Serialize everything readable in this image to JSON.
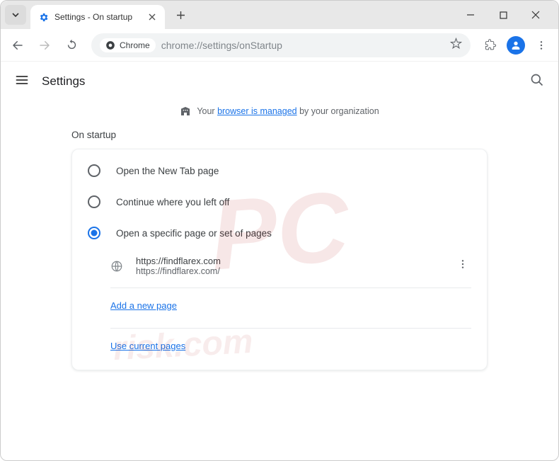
{
  "window": {
    "tab_title": "Settings - On startup"
  },
  "toolbar": {
    "chip_label": "Chrome",
    "url": "chrome://settings/onStartup"
  },
  "settings": {
    "title": "Settings"
  },
  "managed": {
    "prefix": "Your ",
    "link": "browser is managed",
    "suffix": " by your organization"
  },
  "startup": {
    "section_title": "On startup",
    "options": [
      {
        "label": "Open the New Tab page",
        "selected": false
      },
      {
        "label": "Continue where you left off",
        "selected": false
      },
      {
        "label": "Open a specific page or set of pages",
        "selected": true
      }
    ],
    "pages": [
      {
        "title": "https://findflarex.com",
        "url": "https://findflarex.com/"
      }
    ],
    "add_page_label": "Add a new page",
    "use_current_label": "Use current pages"
  }
}
